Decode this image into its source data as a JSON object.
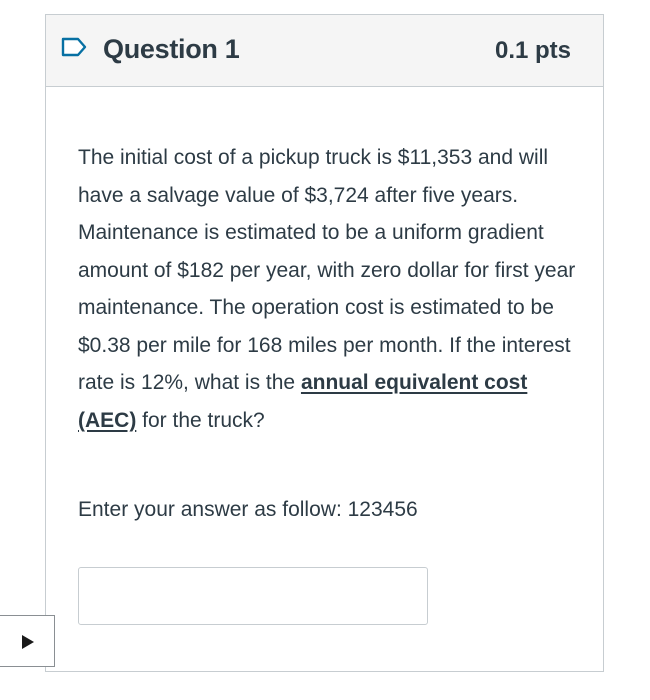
{
  "question": {
    "title": "Question 1",
    "points": "0.1 pts",
    "text_parts": [
      "The initial cost of a pickup truck is $11,353 and will have a salvage value of $3,724 after five years. Maintenance is estimated to be a uniform gradient amount of $182 per year, with zero dollar for first year maintenance. The operation cost is estimated to be $0.38 per mile for 168 miles per month. If the interest rate is 12%, what is the ",
      "annual equivalent cost (AEC)",
      " for the truck?"
    ],
    "instruction": "Enter your answer as follow: 123456",
    "answer": {
      "value": "",
      "placeholder": ""
    }
  },
  "icons": {
    "flag": "bookmark-flag-icon",
    "nav": "play-triangle-icon"
  },
  "colors": {
    "text": "#2d3b45",
    "header_bg": "#f5f5f5",
    "border": "#c7cdd1",
    "flag_stroke": "#0770a3"
  }
}
